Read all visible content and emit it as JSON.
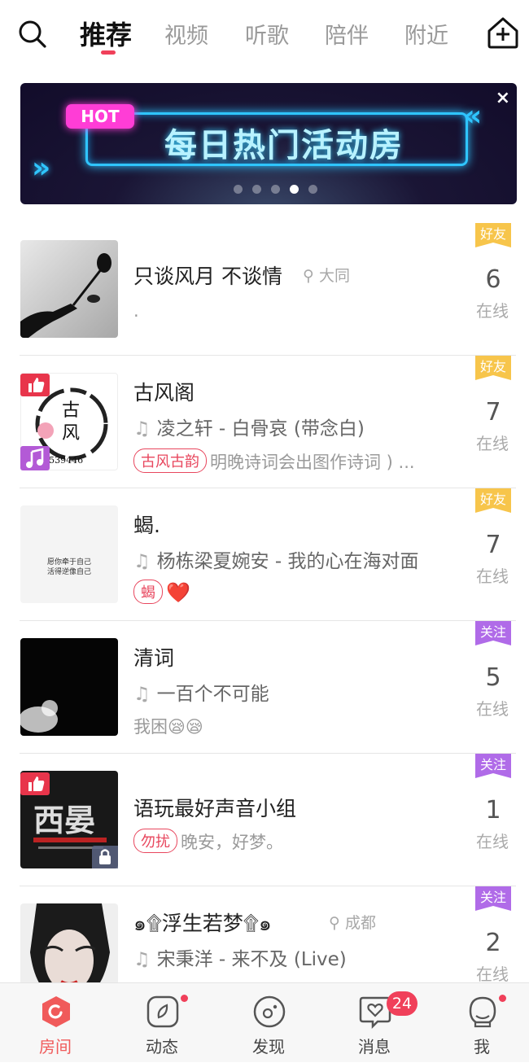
{
  "top_tabs": {
    "tabs": [
      {
        "label": "推荐",
        "active": true
      },
      {
        "label": "视频",
        "active": false
      },
      {
        "label": "听歌",
        "active": false
      },
      {
        "label": "陪伴",
        "active": false
      },
      {
        "label": "附近",
        "active": false
      }
    ],
    "search_icon": "search-icon",
    "create_room_icon": "home-plus-icon"
  },
  "banner": {
    "hot_label": "HOT",
    "title": "每日热门活动房",
    "close_label": "×",
    "page_dots": 5,
    "active_dot": 3
  },
  "rooms": [
    {
      "title": "只谈风月 不谈情",
      "location": "大同",
      "desc": ".",
      "badge": "好友",
      "badge_type": "friend",
      "count": "6",
      "online_label": "在线"
    },
    {
      "title": "古风阁",
      "song": "凌之轩 - 白骨哀 (带念白)",
      "tag": "古风古韵",
      "desc": "明晚诗词会出图作诗词 ) ...",
      "thumb_text": "ID8539446",
      "badge": "好友",
      "badge_type": "friend",
      "count": "7",
      "online_label": "在线"
    },
    {
      "title": "蝎.",
      "song": "杨栋梁夏婉安 - 我的心在海对面",
      "tag": "蝎",
      "desc": "❤️",
      "thumb_text": "愿你牵于自己\n活得逆像自己",
      "badge": "好友",
      "badge_type": "friend",
      "count": "7",
      "online_label": "在线"
    },
    {
      "title": "清词",
      "song": "一百个不可能",
      "desc": "我困😪😪",
      "badge": "关注",
      "badge_type": "follow",
      "count": "5",
      "online_label": "在线"
    },
    {
      "title": "语玩最好声音小组",
      "tag": "勿扰",
      "desc": "晚安，好梦。",
      "badge": "关注",
      "badge_type": "follow",
      "count": "1",
      "online_label": "在线"
    },
    {
      "title": "浮生若梦",
      "title_decor_left": "๑۩",
      "title_decor_right": "۩๑",
      "location": "成都",
      "song": "宋秉洋 - 来不及 (Live)",
      "badge": "关注",
      "badge_type": "follow",
      "count": "2",
      "online_label": "在线"
    }
  ],
  "bottom_nav": {
    "items": [
      {
        "label": "房间",
        "icon": "room-icon",
        "active": true
      },
      {
        "label": "动态",
        "icon": "moments-icon",
        "active": false,
        "dot": true
      },
      {
        "label": "发现",
        "icon": "discover-icon",
        "active": false
      },
      {
        "label": "消息",
        "icon": "message-heart-icon",
        "active": false,
        "count": "24"
      },
      {
        "label": "我",
        "icon": "profile-icon",
        "active": false,
        "dot": true
      }
    ]
  },
  "colors": {
    "accent": "#f0405a",
    "friend_badge": "#f7c54b",
    "follow_badge": "#b06be8",
    "banner_glow": "#2fc5ff"
  }
}
